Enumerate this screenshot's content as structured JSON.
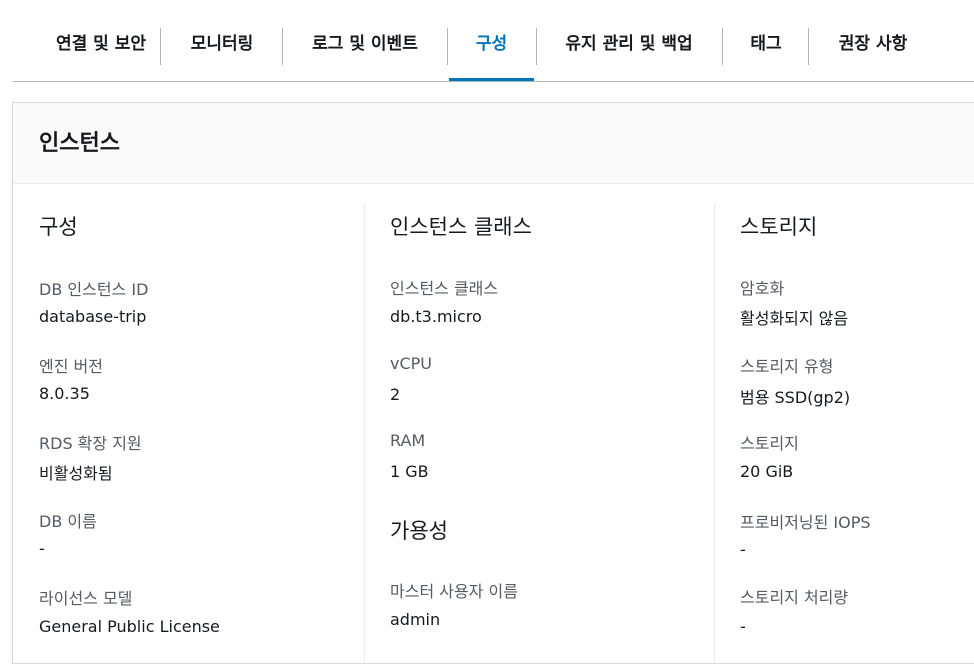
{
  "tabs": [
    {
      "label": "연결 및 보안"
    },
    {
      "label": "모니터링"
    },
    {
      "label": "로그 및 이벤트"
    },
    {
      "label": "구성",
      "active": true
    },
    {
      "label": "유지 관리 및 백업"
    },
    {
      "label": "태그"
    },
    {
      "label": "권장 사항"
    }
  ],
  "panel": {
    "title": "인스턴스"
  },
  "columns": {
    "config": {
      "title": "구성",
      "fields": [
        {
          "label": "DB 인스턴스 ID",
          "value": "database-trip"
        },
        {
          "label": "엔진 버전",
          "value": "8.0.35"
        },
        {
          "label": "RDS 확장 지원",
          "value": "비활성화됨"
        },
        {
          "label": "DB 이름",
          "value": "-"
        },
        {
          "label": "라이선스 모델",
          "value": "General Public License"
        }
      ]
    },
    "instance_class": {
      "title": "인스턴스 클래스",
      "fields": [
        {
          "label": "인스턴스 클래스",
          "value": "db.t3.micro"
        },
        {
          "label": "vCPU",
          "value": "2"
        },
        {
          "label": "RAM",
          "value": "1 GB"
        }
      ]
    },
    "availability": {
      "title": "가용성",
      "fields": [
        {
          "label": "마스터 사용자 이름",
          "value": "admin"
        }
      ]
    },
    "storage": {
      "title": "스토리지",
      "fields": [
        {
          "label": "암호화",
          "value": "활성화되지 않음"
        },
        {
          "label": "스토리지 유형",
          "value": "범용 SSD(gp2)"
        },
        {
          "label": "스토리지",
          "value": "20 GiB"
        },
        {
          "label": "프로비저닝된 IOPS",
          "value": "-"
        },
        {
          "label": "스토리지 처리량",
          "value": "-"
        }
      ]
    }
  },
  "colors": {
    "accent": "#0073bb",
    "text": "#16191f",
    "label": "#545b64",
    "divider": "#aab7b8"
  }
}
